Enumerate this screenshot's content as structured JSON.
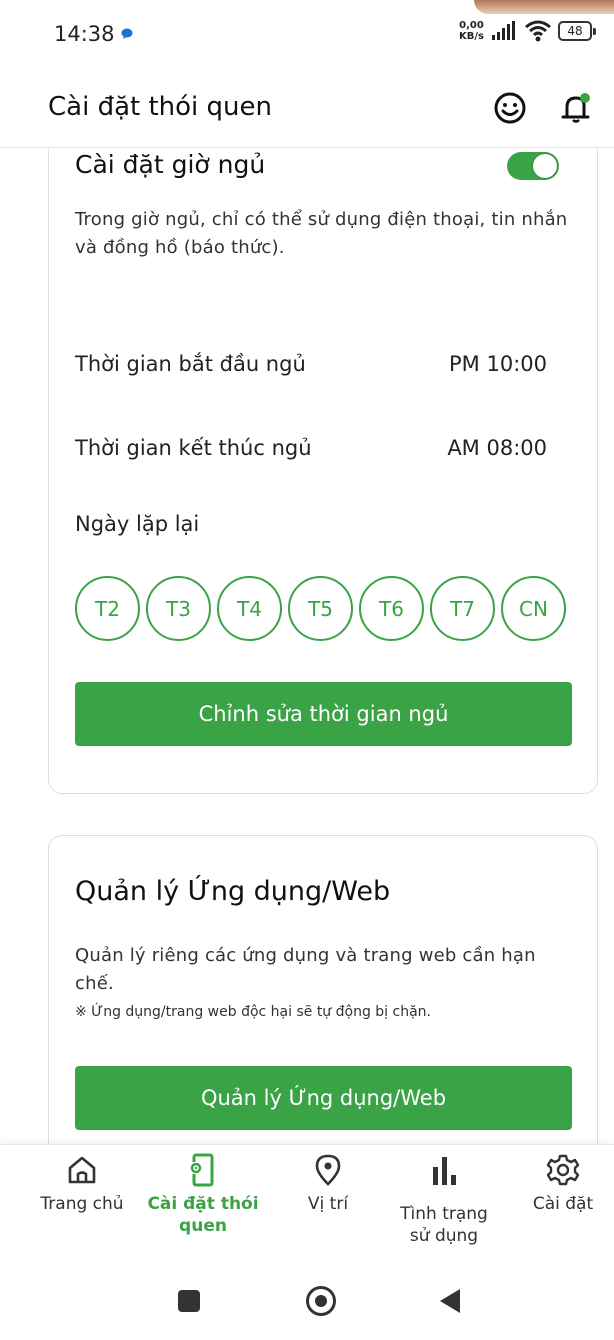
{
  "status_bar": {
    "time": "14:38",
    "net_speed_value": "0,00",
    "net_speed_unit": "KB/s",
    "battery": "48"
  },
  "header": {
    "title": "Cài đặt thói quen",
    "icons": [
      "smile-icon",
      "bell-icon"
    ]
  },
  "sleep_card": {
    "title": "Cài đặt giờ ngủ",
    "toggle_on": true,
    "description": "Trong giờ ngủ, chỉ có thể sử dụng điện thoại, tin nhắn và đồng hồ (báo thức).",
    "start_label": "Thời gian bắt đầu ngủ",
    "start_value": "PM 10:00",
    "end_label": "Thời gian kết thúc ngủ",
    "end_value": "AM 08:00",
    "repeat_label": "Ngày lặp lại",
    "days": [
      "T2",
      "T3",
      "T4",
      "T5",
      "T6",
      "T7",
      "CN"
    ],
    "edit_button": "Chỉnh sửa thời gian ngủ"
  },
  "app_card": {
    "title": "Quản lý Ứng dụng/Web",
    "description": "Quản lý riêng các ứng dụng và trang web cần hạn chế.",
    "note": "※ Ứng dụng/trang web độc hại sẽ tự động bị chặn.",
    "button": "Quản lý Ứng dụng/Web"
  },
  "bottom_nav": {
    "home": "Trang chủ",
    "habit": "Cài đặt thói quen",
    "location": "Vị trí",
    "usage": "Tình trạng sử dụng",
    "settings": "Cài đặt",
    "active": "habit"
  },
  "colors": {
    "accent": "#3aa346",
    "notification_dot": "#3aa346"
  }
}
